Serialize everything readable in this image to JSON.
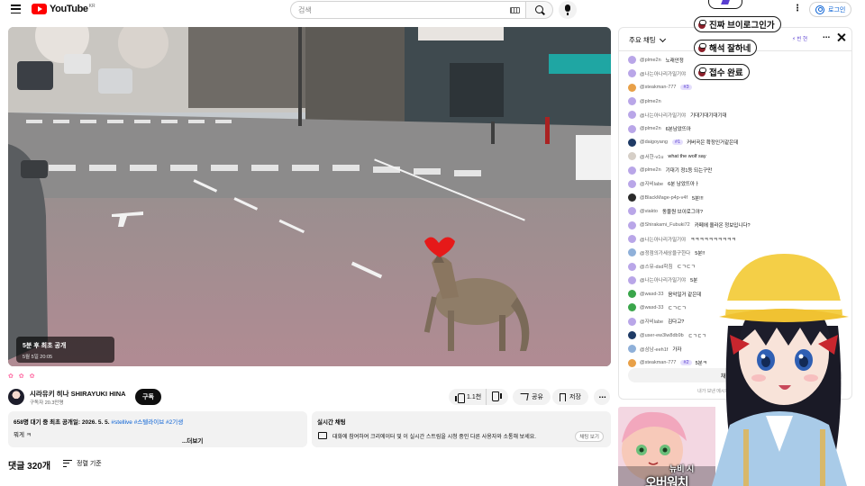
{
  "header": {
    "logo_text": "YouTube",
    "logo_region": "KR",
    "search_placeholder": "검색",
    "more_label": "⋮",
    "login_label": "로그인"
  },
  "player": {
    "premiere_title": "5분 후 최초 공개",
    "premiere_date": "5월 5일 20:05"
  },
  "video": {
    "emoji_row": "✿ ✿ ✿",
    "channel_name": "시라유키 히나 SHIRAYUKI HINA",
    "channel_subs": "구독자 20.3만명",
    "subscribe_label": "구독",
    "like_count": "1.1천",
    "share_label": "공유",
    "save_label": "저장",
    "more_label": "⋯"
  },
  "description": {
    "stats": "658명 대기 중  최초 공개일: 2026. 5. 5.",
    "tags": " #stellive #스텔라이브 #2기생",
    "snippet": "뭐게 ㅋ",
    "more_label": "...더보기"
  },
  "live_chat_card": {
    "title": "실시간 채팅",
    "text": "대화에 참여하여 크리에이터 및 이 실시간 스트림을 시청 중인 다른 사용자와 소통해 보세요.",
    "button": "채팅 보기"
  },
  "comments": {
    "title": "댓글 320개",
    "sort_label": "정렬 기준"
  },
  "chat": {
    "mode_label": "주요 채팅",
    "header_badge": "⚡ 빈 현",
    "header_dots": "⋯",
    "messages": [
      {
        "author": "@plme2n",
        "badge": "",
        "text": "노래안정",
        "color": "#b9a6e8"
      },
      {
        "author": "@나는아나리가밀기야",
        "badge": "",
        "text": "",
        "color": "#b9a6e8"
      },
      {
        "author": "@steakman-777",
        "badge": "#3",
        "text": "",
        "color": "#e8a048"
      },
      {
        "author": "@plme2n",
        "badge": "",
        "text": "",
        "color": "#b9a6e8"
      },
      {
        "author": "@나는아나리가밀기야",
        "badge": "",
        "text": "기대기대기대기대",
        "color": "#b9a6e8"
      },
      {
        "author": "@plme2n",
        "badge": "",
        "text": "6분남았뜨아",
        "color": "#b9a6e8"
      },
      {
        "author": "@daigoyang",
        "badge": "#1",
        "text": "커버곡은 확정인거같은데",
        "color": "#1f3b66"
      },
      {
        "author": "@서한-v1u",
        "badge": "",
        "text": "what the wolf say",
        "color": "#d6cfc7"
      },
      {
        "author": "@plme2n",
        "badge": "",
        "text": "기대기 정1등 되는구만",
        "color": "#b9a6e8"
      },
      {
        "author": "@자비labe",
        "badge": "",
        "text": "6분 남았뜨아ㅏ",
        "color": "#b9a6e8"
      },
      {
        "author": "@BlackMage-p4p-v4f",
        "badge": "",
        "text": "5분!!!",
        "color": "#2a2a2a"
      },
      {
        "author": "@viakto",
        "badge": "",
        "text": "동물원 브이로그야?",
        "color": "#b9a6e8"
      },
      {
        "author": "@Shirakami_Fubuki72",
        "badge": "",
        "text": "카페에 올라온 정보입니다?",
        "color": "#b9a6e8"
      },
      {
        "author": "@나는아나리가밀기야",
        "badge": "",
        "text": "ㅋㅋㅋㅋㅋㅋㅋㅋㅋㅋ",
        "color": "#b9a6e8"
      },
      {
        "author": "@정점의가세상을구한다",
        "badge": "",
        "text": "5분!!",
        "color": "#8fb0d9"
      },
      {
        "author": "@스뮤-dsd학침",
        "badge": "",
        "text": "ㄷㄱㄷㄱ",
        "color": "#b9a6e8"
      },
      {
        "author": "@나는아나리가밀기야",
        "badge": "",
        "text": "5분",
        "color": "#b9a6e8"
      },
      {
        "author": "@wasd-33",
        "badge": "",
        "text": "음악일거 같은데",
        "color": "#3aa64b"
      },
      {
        "author": "@wasd-33",
        "badge": "",
        "text": "ㄷㄱㄷㄱ",
        "color": "#3aa64b"
      },
      {
        "author": "@자비labe",
        "badge": "",
        "text": "김다고?",
        "color": "#b9a6e8"
      },
      {
        "author": "@user-ew3lw8db9b",
        "badge": "",
        "text": "ㄷㄱㄷㄱ",
        "color": "#1f3b66"
      },
      {
        "author": "@삼남-eeh1f",
        "badge": "",
        "text": "가자",
        "color": "#8fb0d9"
      },
      {
        "author": "@steakman-777",
        "badge": "#2",
        "text": "5분ㅋ",
        "color": "#e8a048"
      }
    ],
    "input_label": "채팅하세요...",
    "footer": "내가 보낸 메시지는 모두에게 공개됩니다"
  },
  "overlay": {
    "bubbles": [
      "진짜 브이로그인가",
      "해석 잘하네",
      "접수 완료"
    ],
    "promo_line1": "뉴비 시",
    "promo_line2": "오버워치"
  },
  "colors": {
    "accent": "#ff0000",
    "link": "#065fd4",
    "chat_badge": "#5a3fd1",
    "panel_bg": "#f2f2f2"
  }
}
